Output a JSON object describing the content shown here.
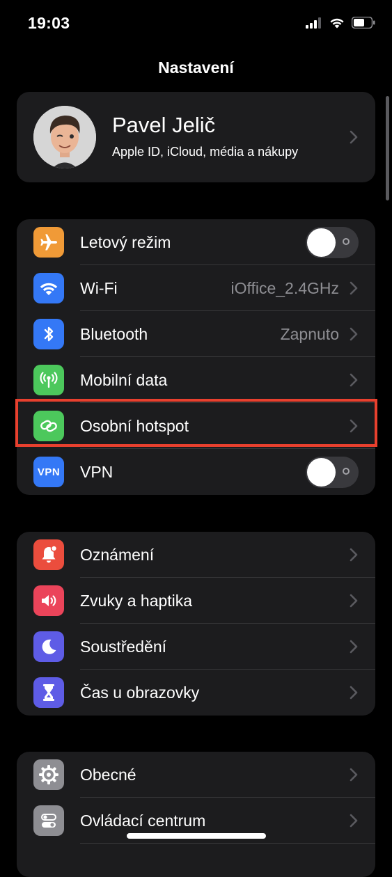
{
  "status_bar": {
    "time": "19:03"
  },
  "nav": {
    "title": "Nastavení"
  },
  "profile": {
    "name": "Pavel Jelič",
    "subtitle": "Apple ID, iCloud, média a nákupy"
  },
  "connectivity": [
    {
      "label": "Letový režim",
      "icon": "airplane-icon",
      "color": "#f09a37",
      "control": "toggle",
      "toggle_on": false
    },
    {
      "label": "Wi-Fi",
      "icon": "wifi-icon",
      "color": "#3478f6",
      "value": "iOffice_2.4GHz"
    },
    {
      "label": "Bluetooth",
      "icon": "bluetooth-icon",
      "color": "#3478f6",
      "value": "Zapnuto"
    },
    {
      "label": "Mobilní data",
      "icon": "antenna-icon",
      "color": "#4cc85c"
    },
    {
      "label": "Osobní hotspot",
      "icon": "hotspot-link-icon",
      "color": "#4cc85c",
      "highlighted": true
    },
    {
      "label": "VPN",
      "icon_text": "VPN",
      "icon": "vpn-icon",
      "color": "#3478f6",
      "control": "toggle",
      "toggle_on": false
    }
  ],
  "notifications": [
    {
      "label": "Oznámení",
      "icon": "bell-icon",
      "color": "#eb4d3d"
    },
    {
      "label": "Zvuky a haptika",
      "icon": "speaker-icon",
      "color": "#eb445a"
    },
    {
      "label": "Soustředění",
      "icon": "moon-icon",
      "color": "#5e5ce6"
    },
    {
      "label": "Čas u obrazovky",
      "icon": "hourglass-icon",
      "color": "#5e5ce6"
    }
  ],
  "general": [
    {
      "label": "Obecné",
      "icon": "gear-icon",
      "color": "#8e8e93"
    },
    {
      "label": "Ovládací centrum",
      "icon": "switches-icon",
      "color": "#8e8e93"
    }
  ],
  "colors": {
    "background": "#000000",
    "card": "#1c1c1e",
    "separator": "#38383a",
    "highlight": "#e8402e",
    "secondary_text": "#8e8e93"
  }
}
